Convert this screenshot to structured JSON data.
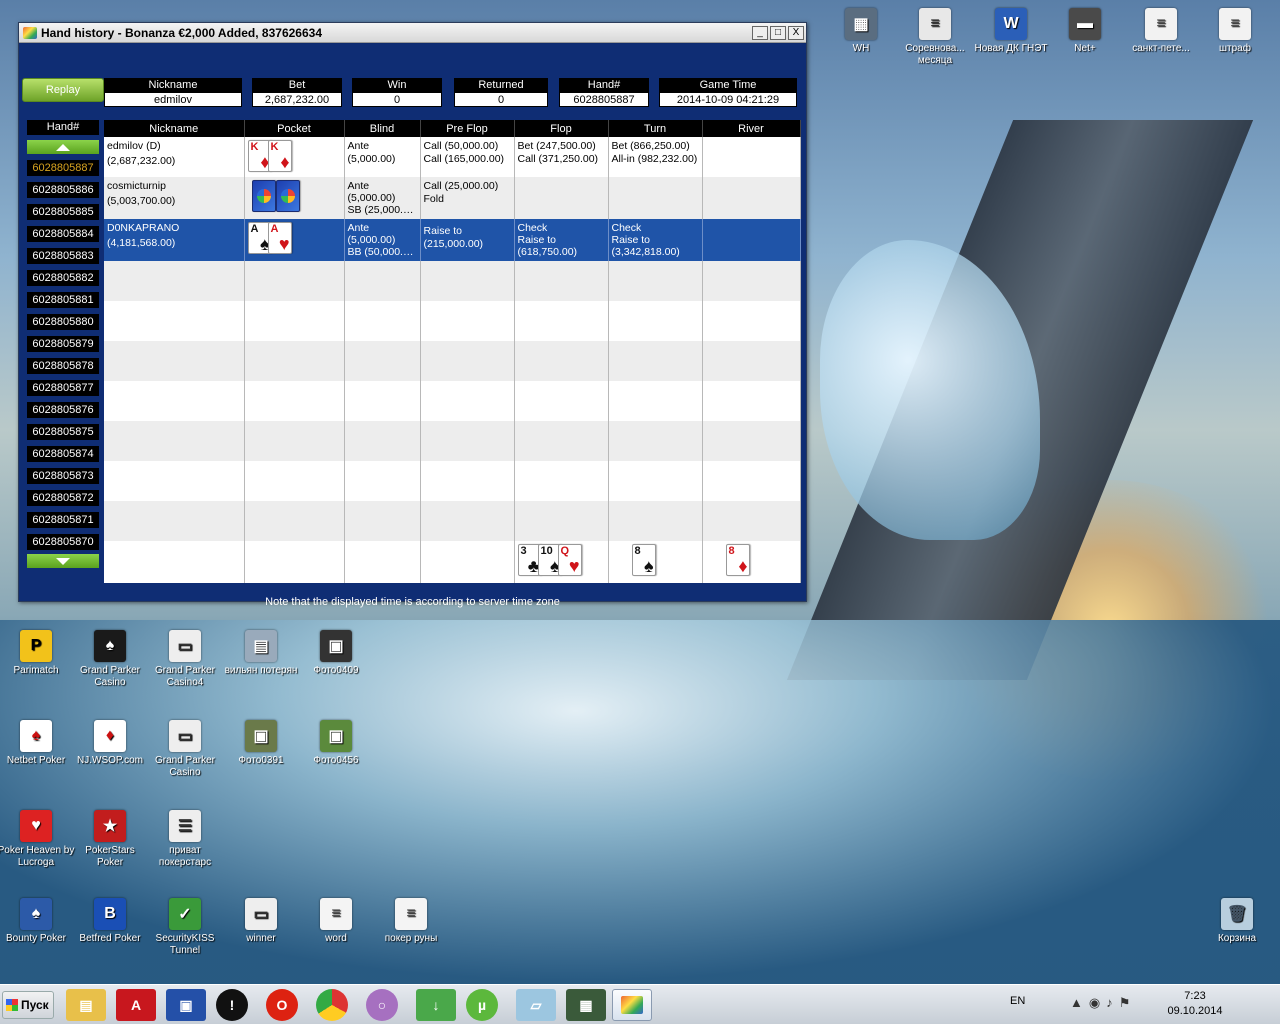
{
  "window": {
    "title": "Hand history - Bonanza €2,000 Added, 837626634",
    "buttons": {
      "minimize": "_",
      "maximize": "□",
      "close": "X"
    }
  },
  "replay_label": "Replay",
  "summary": {
    "headers": [
      "Nickname",
      "Bet",
      "Win",
      "Returned",
      "Hand#",
      "Game Time"
    ],
    "values": [
      "edmilov",
      "2,687,232.00",
      "0",
      "0",
      "6028805887",
      "2014-10-09 04:21:29"
    ]
  },
  "hand_list": {
    "header": "Hand#",
    "items": [
      "6028805887",
      "6028805886",
      "6028805885",
      "6028805884",
      "6028805883",
      "6028805882",
      "6028805881",
      "6028805880",
      "6028805879",
      "6028805878",
      "6028805877",
      "6028805876",
      "6028805875",
      "6028805874",
      "6028805873",
      "6028805872",
      "6028805871",
      "6028805870"
    ]
  },
  "grid": {
    "headers": [
      "Nickname",
      "Pocket",
      "Blind",
      "Pre Flop",
      "Flop",
      "Turn",
      "River"
    ],
    "players": [
      {
        "name": "edmilov (D)",
        "stack": "(2,687,232.00)",
        "blind": [
          "Ante",
          "(5,000.00)"
        ],
        "preflop": [
          "Call (50,000.00)",
          "Call (165,000.00)"
        ],
        "flop": [
          "Bet (247,500.00)",
          "Call (371,250.00)"
        ],
        "turn": [
          "Bet (866,250.00)",
          "All-in (982,232.00)"
        ],
        "river": []
      },
      {
        "name": "cosmicturnip",
        "stack": "(5,003,700.00)",
        "blind": [
          "Ante",
          "(5,000.00)",
          "SB (25,000.…"
        ],
        "preflop": [
          "Call (25,000.00)",
          "Fold"
        ],
        "flop": [],
        "turn": [],
        "river": []
      },
      {
        "name": "D0NKAPRANO",
        "stack": "(4,181,568.00)",
        "blind": [
          "Ante",
          "(5,000.00)",
          "BB (50,000.…"
        ],
        "preflop": [
          "Raise to",
          "(215,000.00)"
        ],
        "flop": [
          "Check",
          "Raise to",
          "(618,750.00)"
        ],
        "turn": [
          "Check",
          "Raise to",
          "(3,342,818.00)"
        ],
        "river": []
      }
    ],
    "pocket_cards": [
      [
        {
          "rank": "K",
          "suit": "♦"
        },
        {
          "rank": "K",
          "suit": "♦"
        }
      ],
      [
        {
          "rank": "",
          "suit": "back"
        },
        {
          "rank": "",
          "suit": "back"
        }
      ],
      [
        {
          "rank": "A",
          "suit": "♠"
        },
        {
          "rank": "A",
          "suit": "♥"
        }
      ]
    ],
    "board": {
      "flop": [
        {
          "rank": "3",
          "suit": "♣"
        },
        {
          "rank": "10",
          "suit": "♠"
        },
        {
          "rank": "Q",
          "suit": "♥"
        }
      ],
      "turn": [
        {
          "rank": "8",
          "suit": "♠"
        }
      ],
      "river": [
        {
          "rank": "8",
          "suit": "♦"
        }
      ]
    }
  },
  "note": "Note that the displayed time is according to server time zone",
  "desktop_icons": {
    "top": [
      "WH",
      "Соревнова... месяца",
      "Новая ДК ГНЭТ",
      "Net+",
      "санкт-пете...",
      "штраф"
    ],
    "left": [
      "Parimatch",
      "Grand Parker Casino",
      "Grand Parker Casino4",
      "вильян потерян",
      "Фото0409",
      "Netbet Poker",
      "NJ.WSOP.com",
      "Grand Parker Casino",
      "Фото0391",
      "Фото0456",
      "Poker Heaven by Lucroga",
      "PokerStars Poker",
      "приват покерстарс",
      "Bounty Poker",
      "Betfred Poker",
      "SecurityKISS Tunnel",
      "winner",
      "word",
      "покер руны"
    ],
    "recycle": "Корзина"
  },
  "taskbar": {
    "start": "Пуск",
    "lang": "EN",
    "time": "7:23",
    "date": "09.10.2014"
  }
}
